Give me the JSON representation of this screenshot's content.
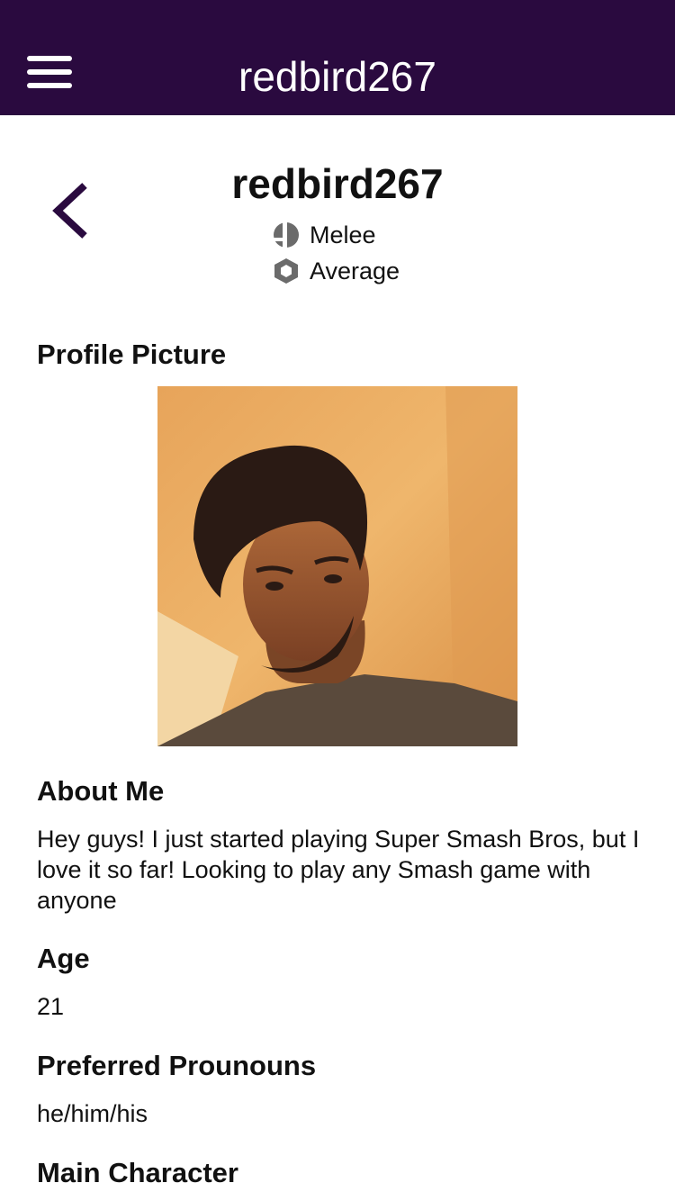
{
  "header": {
    "title": "redbird267",
    "menu_icon": "hamburger-menu-icon",
    "background_color": "#2a0a3f"
  },
  "profile": {
    "back_icon": "chevron-left-icon",
    "username": "redbird267",
    "game": {
      "icon": "smash-ball-icon",
      "label": "Melee"
    },
    "skill": {
      "icon": "hexagon-icon",
      "label": "Average"
    }
  },
  "sections": {
    "profile_picture": {
      "title": "Profile Picture"
    },
    "about": {
      "title": "About Me",
      "text": "Hey guys! I just started playing Super Smash Bros, but I love it so far! Looking to play any Smash game with anyone"
    },
    "age": {
      "title": "Age",
      "value": "21"
    },
    "pronouns": {
      "title": "Preferred Prounouns",
      "value": "he/him/his"
    },
    "main_character": {
      "title": "Main Character"
    }
  }
}
